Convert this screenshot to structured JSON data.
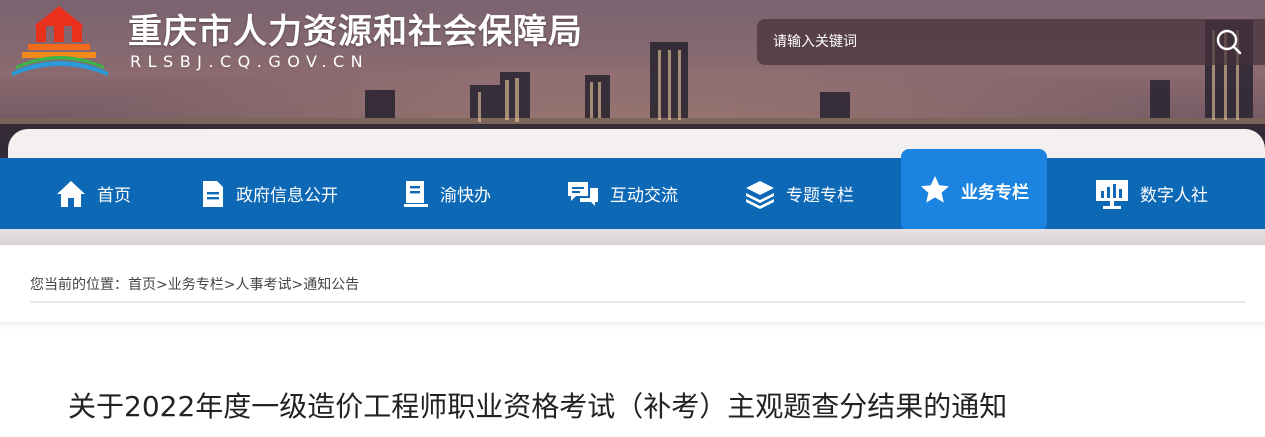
{
  "header": {
    "site_title": "重庆市人力资源和社会保障局",
    "site_domain": "RLSBJ.CQ.GOV.CN",
    "search": {
      "placeholder": "请输入关键词"
    }
  },
  "nav": {
    "items": [
      {
        "label": "首页",
        "icon": "home-icon",
        "active": false
      },
      {
        "label": "政府信息公开",
        "icon": "document-icon",
        "active": false
      },
      {
        "label": "渝快办",
        "icon": "book-icon",
        "active": false
      },
      {
        "label": "互动交流",
        "icon": "chat-icon",
        "active": false
      },
      {
        "label": "专题专栏",
        "icon": "layers-icon",
        "active": false
      },
      {
        "label": "业务专栏",
        "icon": "star-icon",
        "active": true
      },
      {
        "label": "数字人社",
        "icon": "monitor-chart-icon",
        "active": false
      }
    ],
    "colors": {
      "bar": "#0d68b6",
      "active": "#1b84e0"
    }
  },
  "breadcrumb": {
    "prefix": "您当前的位置：",
    "items": [
      "首页",
      "业务专栏",
      "人事考试",
      "通知公告"
    ],
    "separator": ">"
  },
  "article": {
    "title": "关于2022年度一级造价工程师职业资格考试（补考）主观题查分结果的通知"
  }
}
